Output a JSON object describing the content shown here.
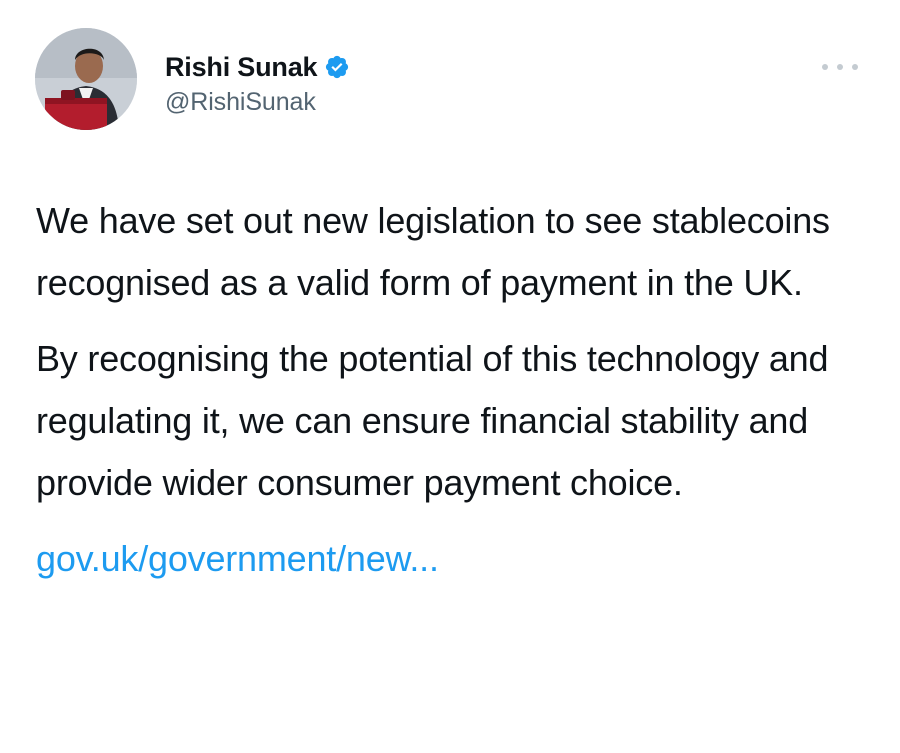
{
  "tweet": {
    "author": {
      "display_name": "Rishi Sunak",
      "handle": "@RishiSunak",
      "verified": true,
      "avatar_icon": "profile-photo"
    },
    "more_icon": "more-horizontal-icon",
    "paragraphs": [
      "We have set out new legislation to see stablecoins recognised as a valid form of payment in the UK.",
      "By recognising the potential of this technology and regulating it, we can ensure financial stability and provide wider consumer payment choice."
    ],
    "link_text": "gov.uk/government/new..."
  },
  "colors": {
    "text_primary": "#0f1419",
    "text_secondary": "#536471",
    "link": "#1d9bf0",
    "verified_badge": "#1d9bf0"
  }
}
